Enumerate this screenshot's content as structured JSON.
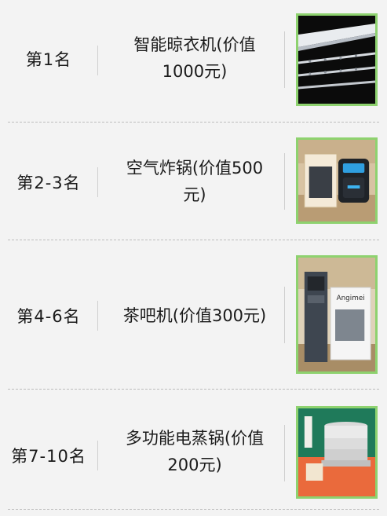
{
  "prizes": [
    {
      "rank": "第1名",
      "name_line1": "智能晾衣机(价值",
      "name_line2": "1000元)",
      "image": "clothes-rack-image"
    },
    {
      "rank": "第2-3名",
      "name_line1": "空气炸锅(价值500",
      "name_line2": "元)",
      "image": "air-fryer-image"
    },
    {
      "rank": "第4-6名",
      "name_line1": "茶吧机(价值300元)",
      "name_line2": "",
      "image": "tea-bar-machine-image"
    },
    {
      "rank": "第7-10名",
      "name_line1": "多功能电蒸锅(价值",
      "name_line2": "200元)",
      "image": "electric-steamer-image"
    }
  ],
  "brand_text": {
    "tea_machine_box": "Angimei"
  },
  "colors": {
    "thumb_border": "#8ed26f",
    "background": "#f3f3f3"
  }
}
